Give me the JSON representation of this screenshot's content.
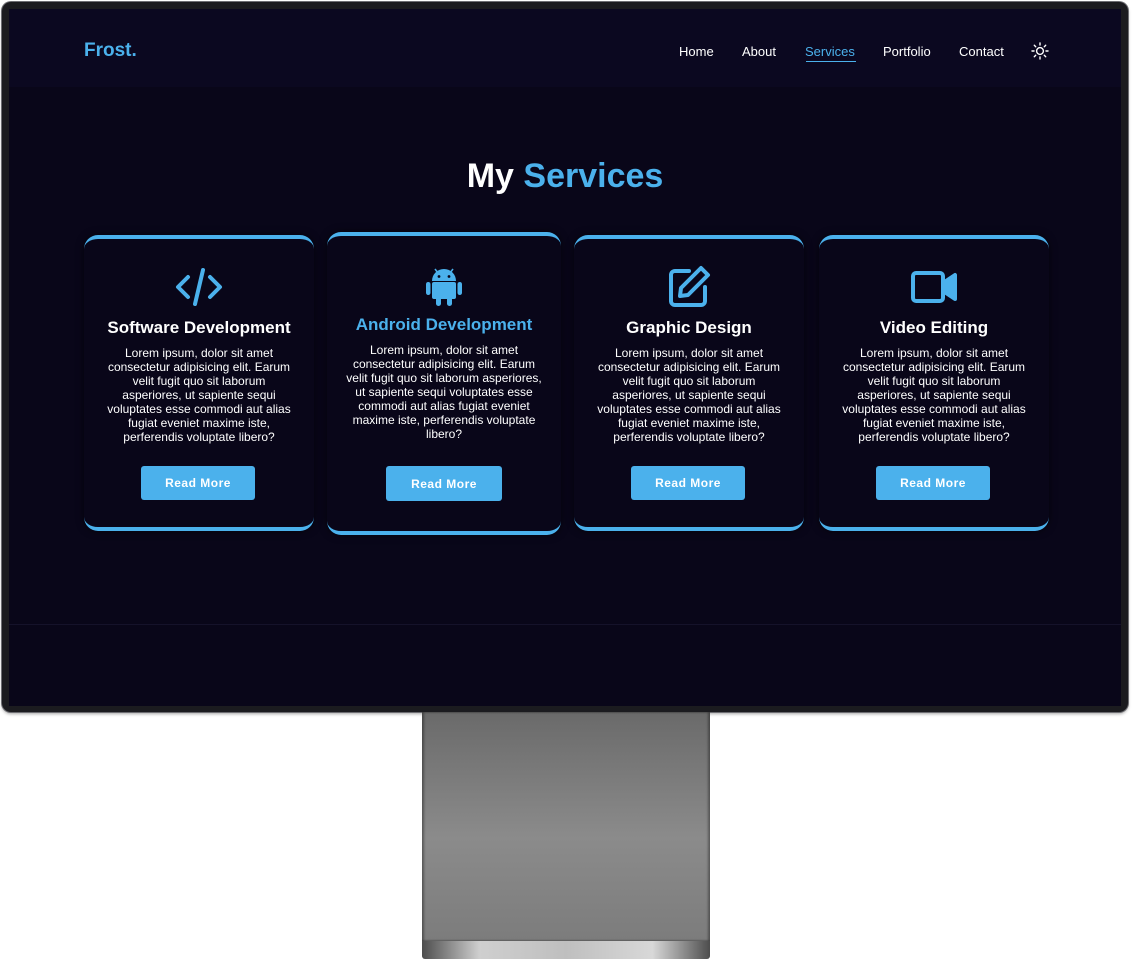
{
  "brand": {
    "logo": "Frost."
  },
  "nav": {
    "items": [
      {
        "label": "Home"
      },
      {
        "label": "About"
      },
      {
        "label": "Services",
        "active": true
      },
      {
        "label": "Portfolio"
      },
      {
        "label": "Contact"
      }
    ],
    "theme_toggle_icon": "sun-icon"
  },
  "heading": {
    "word1": "My",
    "word2": "Services"
  },
  "cards": [
    {
      "icon": "code-icon",
      "title": "Software Development",
      "text": "Lorem ipsum, dolor sit amet consectetur adipisicing elit. Earum velit fugit quo sit laborum asperiores, ut sapiente sequi voluptates esse commodi aut alias fugiat eveniet maxime iste, perferendis voluptate libero?",
      "button": "Read More"
    },
    {
      "icon": "android-icon",
      "title": "Android Development",
      "text": "Lorem ipsum, dolor sit amet consectetur adipisicing elit. Earum velit fugit quo sit laborum asperiores, ut sapiente sequi voluptates esse commodi aut alias fugiat eveniet maxime iste, perferendis voluptate libero?",
      "button": "Read More"
    },
    {
      "icon": "edit-icon",
      "title": "Graphic Design",
      "text": "Lorem ipsum, dolor sit amet consectetur adipisicing elit. Earum velit fugit quo sit laborum asperiores, ut sapiente sequi voluptates esse commodi aut alias fugiat eveniet maxime iste, perferendis voluptate libero?",
      "button": "Read More"
    },
    {
      "icon": "video-camera-icon",
      "title": "Video Editing",
      "text": "Lorem ipsum, dolor sit amet consectetur adipisicing elit. Earum velit fugit quo sit laborum asperiores, ut sapiente sequi voluptates esse commodi aut alias fugiat eveniet maxime iste, perferendis voluptate libero?",
      "button": "Read More"
    }
  ],
  "colors": {
    "accent": "#4bb1ec",
    "background": "#090619",
    "text": "#ffffff"
  }
}
